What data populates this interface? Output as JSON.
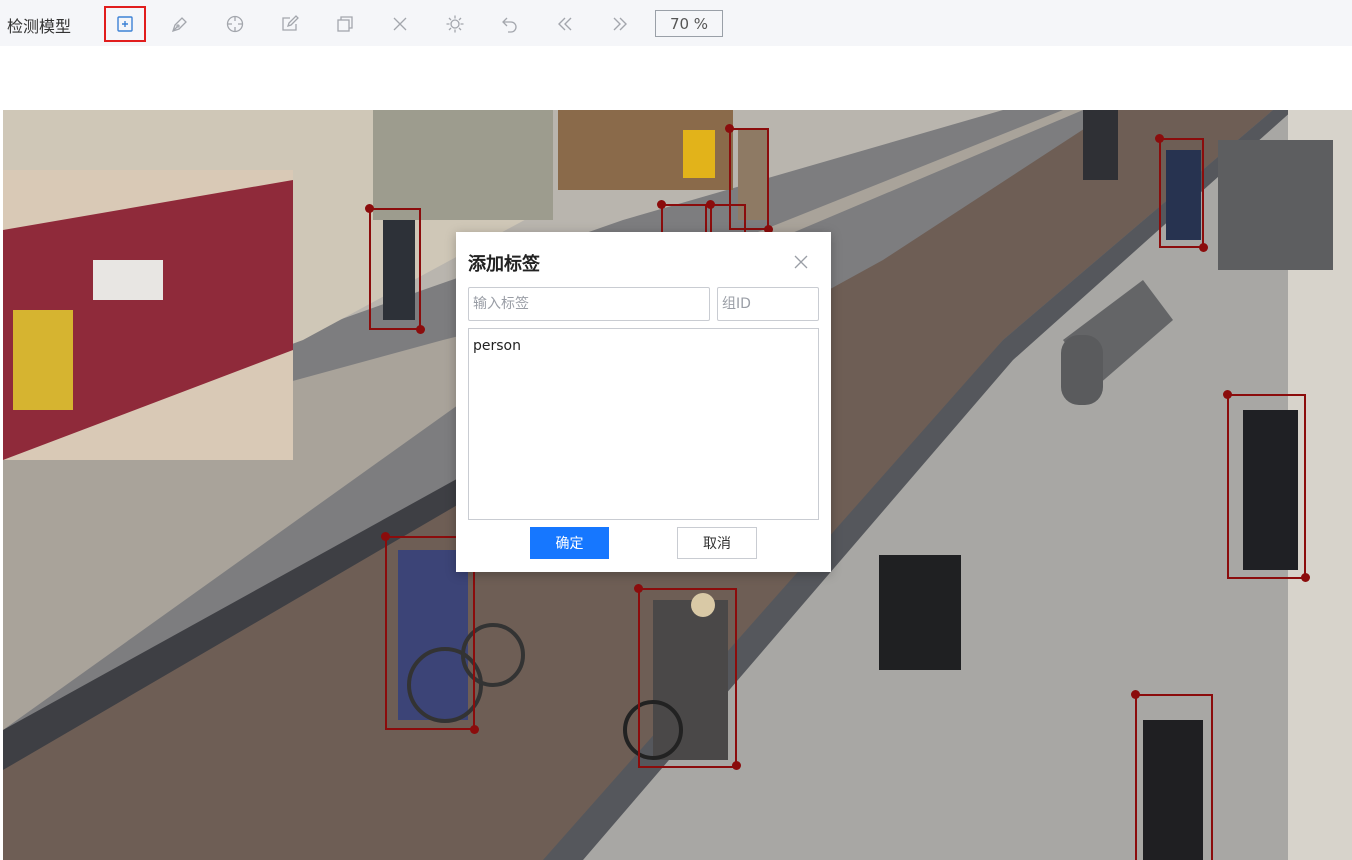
{
  "toolbar": {
    "title": "检测模型",
    "zoom": "70 %",
    "tools": [
      {
        "name": "create-box-icon",
        "active": true
      },
      {
        "name": "pen-icon",
        "active": false
      },
      {
        "name": "crosshair-icon",
        "active": false
      },
      {
        "name": "edit-icon",
        "active": false
      },
      {
        "name": "copy-icon",
        "active": false
      },
      {
        "name": "delete-icon",
        "active": false
      },
      {
        "name": "brightness-icon",
        "active": false
      },
      {
        "name": "undo-icon",
        "active": false
      },
      {
        "name": "previous-icon",
        "active": false
      },
      {
        "name": "next-icon",
        "active": false
      }
    ]
  },
  "colors": {
    "active_tool_border": "#e11d1d",
    "bbox": "#8b0c0c",
    "primary": "#1677ff"
  },
  "dialog": {
    "title": "添加标签",
    "label_placeholder": "输入标签",
    "group_placeholder": "组ID",
    "labels": [
      "person"
    ],
    "ok_label": "确定",
    "cancel_label": "取消"
  }
}
